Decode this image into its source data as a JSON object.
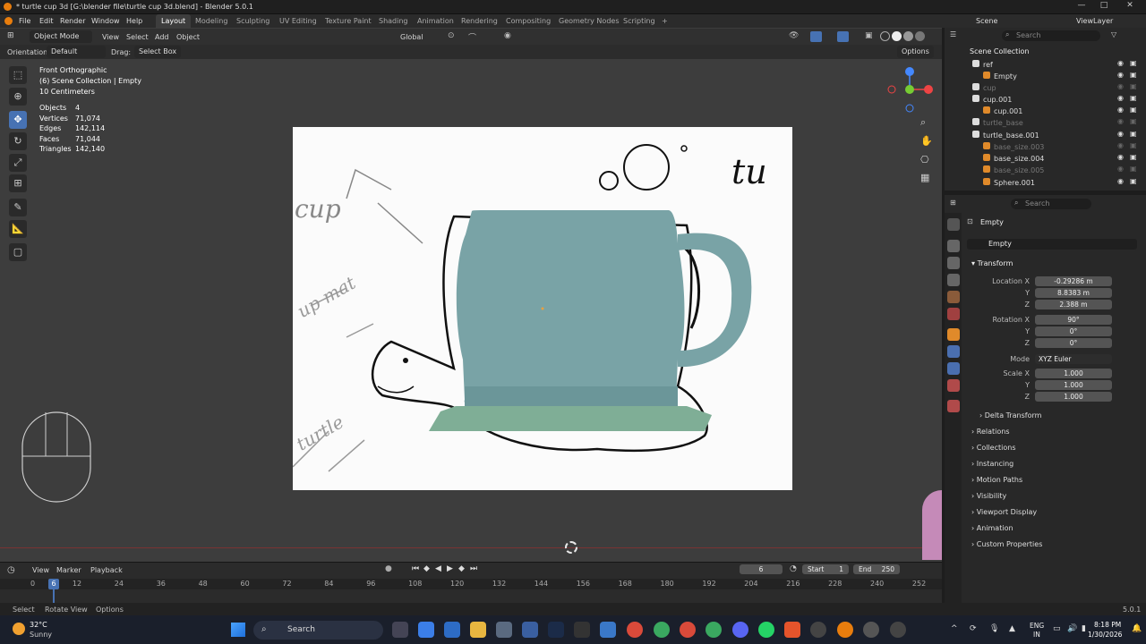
{
  "window": {
    "title": "* turtle cup 3d [G:\\blender file\\turtle cup 3d.blend] - Blender 5.0.1",
    "minimize": "—",
    "maximize": "□",
    "close": "✕"
  },
  "menu": [
    "File",
    "Edit",
    "Render",
    "Window",
    "Help"
  ],
  "workspaces": [
    "Layout",
    "Modeling",
    "Sculpting",
    "UV Editing",
    "Texture Paint",
    "Shading",
    "Animation",
    "Rendering",
    "Compositing",
    "Geometry Nodes",
    "Scripting"
  ],
  "workspace_add": "+",
  "scene": {
    "label": "Scene",
    "viewlayer": "ViewLayer"
  },
  "viewport_header": {
    "mode": "Object Mode",
    "menus": [
      "View",
      "Select",
      "Add",
      "Object"
    ],
    "transform_orientation": "Global"
  },
  "tool_header": {
    "orientation_label": "Orientation:",
    "orientation_value": "Default",
    "drag_label": "Drag:",
    "drag_value": "Select Box",
    "options": "Options"
  },
  "overlay_text": {
    "view_name": "Front Orthographic",
    "collection": "(6) Scene Collection | Empty",
    "scale": "10 Centimeters"
  },
  "stats": [
    {
      "label": "Objects",
      "value": "4"
    },
    {
      "label": "Vertices",
      "value": "71,074"
    },
    {
      "label": "Edges",
      "value": "142,114"
    },
    {
      "label": "Faces",
      "value": "71,044"
    },
    {
      "label": "Triangles",
      "value": "142,140"
    }
  ],
  "sketch_words": {
    "cup": "cup",
    "w1": "up mat",
    "w2": "turtle",
    "w3": "tu"
  },
  "outliner": {
    "search_placeholder": "Search",
    "root": "Scene Collection",
    "items": [
      {
        "name": "ref",
        "level": 1
      },
      {
        "name": "Empty",
        "level": 2
      },
      {
        "name": "cup",
        "level": 1,
        "dim": true
      },
      {
        "name": "cup.001",
        "level": 1
      },
      {
        "name": "cup.001",
        "level": 2
      },
      {
        "name": "turtle_base",
        "level": 1,
        "dim": true
      },
      {
        "name": "turtle_base.001",
        "level": 1
      },
      {
        "name": "base_size.003",
        "level": 2,
        "dim": true
      },
      {
        "name": "base_size.004",
        "level": 2
      },
      {
        "name": "base_size.005",
        "level": 2,
        "dim": true
      },
      {
        "name": "Sphere.001",
        "level": 2
      }
    ]
  },
  "properties": {
    "search_placeholder": "Search",
    "object_name": "Empty",
    "object_field": "Empty",
    "transform_label": "Transform",
    "location": {
      "label_x": "Location X",
      "x": "-0.29286 m",
      "y": "8.8383 m",
      "z": "2.388 m"
    },
    "rotation": {
      "label_x": "Rotation X",
      "x": "90°",
      "y": "0°",
      "z": "0°"
    },
    "mode_label": "Mode",
    "mode_value": "XYZ Euler",
    "scale": {
      "label_x": "Scale X",
      "x": "1.000",
      "y": "1.000",
      "z": "1.000"
    },
    "axis_y": "Y",
    "axis_z": "Z",
    "panels": [
      "Delta Transform",
      "Relations",
      "Collections",
      "Instancing",
      "Motion Paths",
      "Visibility",
      "Viewport Display",
      "Animation",
      "Custom Properties"
    ]
  },
  "timeline": {
    "menus": [
      "View",
      "Marker",
      "Playback"
    ],
    "current_frame": "6",
    "start_label": "Start",
    "start": "1",
    "end_label": "End",
    "end": "250",
    "ruler": [
      "0",
      "12",
      "24",
      "36",
      "48",
      "60",
      "72",
      "84",
      "96",
      "108",
      "120",
      "132",
      "144",
      "156",
      "168",
      "180",
      "192",
      "204",
      "216",
      "228",
      "240",
      "252"
    ],
    "playhead": "6"
  },
  "statusbar": {
    "items": [
      "Select",
      "Rotate View",
      "Options"
    ],
    "version": "5.0.1"
  },
  "taskbar": {
    "weather_temp": "32°C",
    "weather_desc": "Sunny",
    "search": "Search",
    "lang1": "ENG",
    "lang2": "IN",
    "time": "8:18 PM",
    "date": "1/30/2026"
  },
  "colors": {
    "accent": "#4772b3",
    "cup": "#79a3a6",
    "saucer": "#7fae96",
    "viewport": "#3d3d3d"
  }
}
